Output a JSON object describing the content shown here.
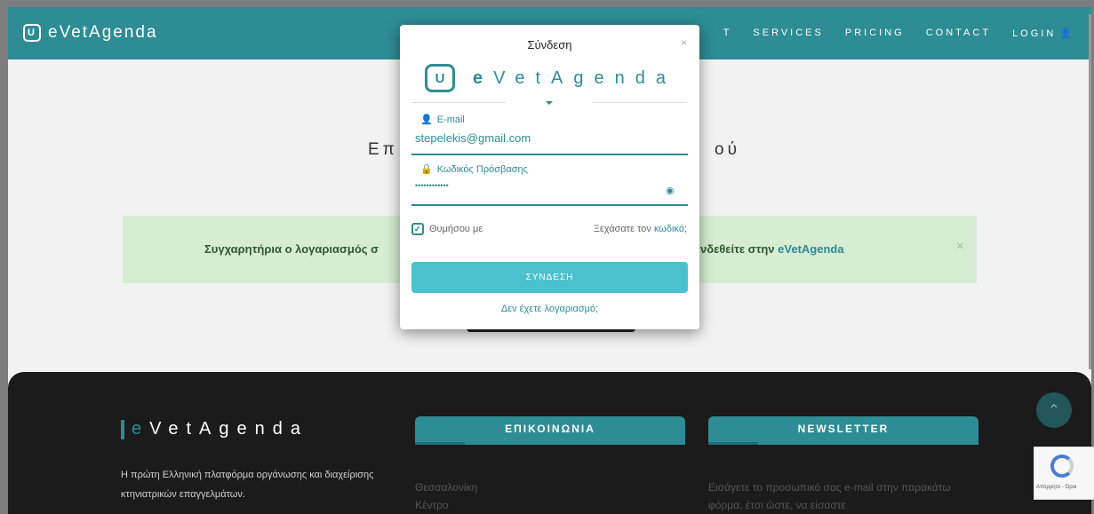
{
  "header": {
    "brand": "eVetAgenda",
    "nav": [
      "T",
      "SERVICES",
      "PRICING",
      "CONTACT",
      "LOGIN"
    ]
  },
  "main": {
    "heading_left": "Επ",
    "heading_right": "ού",
    "alert_left": "Συγχαρητήρια ο λογαριασμός σ",
    "alert_right_prefix": "νδεθείτε στην ",
    "alert_link": "eVetAgenda",
    "alert_close": "×"
  },
  "modal": {
    "title": "Σύνδεση",
    "close": "×",
    "logo_text": "VetAgenda",
    "logo_e": "e",
    "email_label": "E-mail",
    "email_value": "stepelekis@gmail.com",
    "password_label": "Κωδικός Πρόσβασης",
    "password_value": "••••••••••••",
    "remember_label": "Θυμήσου με",
    "forgot_prefix": "Ξεχάσατε τον ",
    "forgot_link": "κωδικό;",
    "login_button": "ΣΥΝΔΕΣΗ",
    "no_account": "Δεν έχετε λογαριασμό;"
  },
  "footer": {
    "brand_e": "e",
    "brand_rest": "VetAgenda",
    "description": "Η πρώτη Ελληνική πλατφόρμα οργάνωσης και διαχείρισης κτηνιατρικών επαγγελμάτων.",
    "contact_title": "ΕΠΙΚΟΙΝΩΝΙΑ",
    "contact_lines": [
      "Θεσσαλονίκη",
      "Κέντρο"
    ],
    "newsletter_title": "NEWSLETTER",
    "newsletter_text": "Εισάγετε το προσωπικό σας e-mail στην παρακάτω φόρμα, έτσι ώστε, να είσαστε"
  },
  "recaptcha": {
    "text": "Απόρρητο - Όροι"
  },
  "colors": {
    "accent": "#2e8c95",
    "button": "#4ac1cc"
  }
}
